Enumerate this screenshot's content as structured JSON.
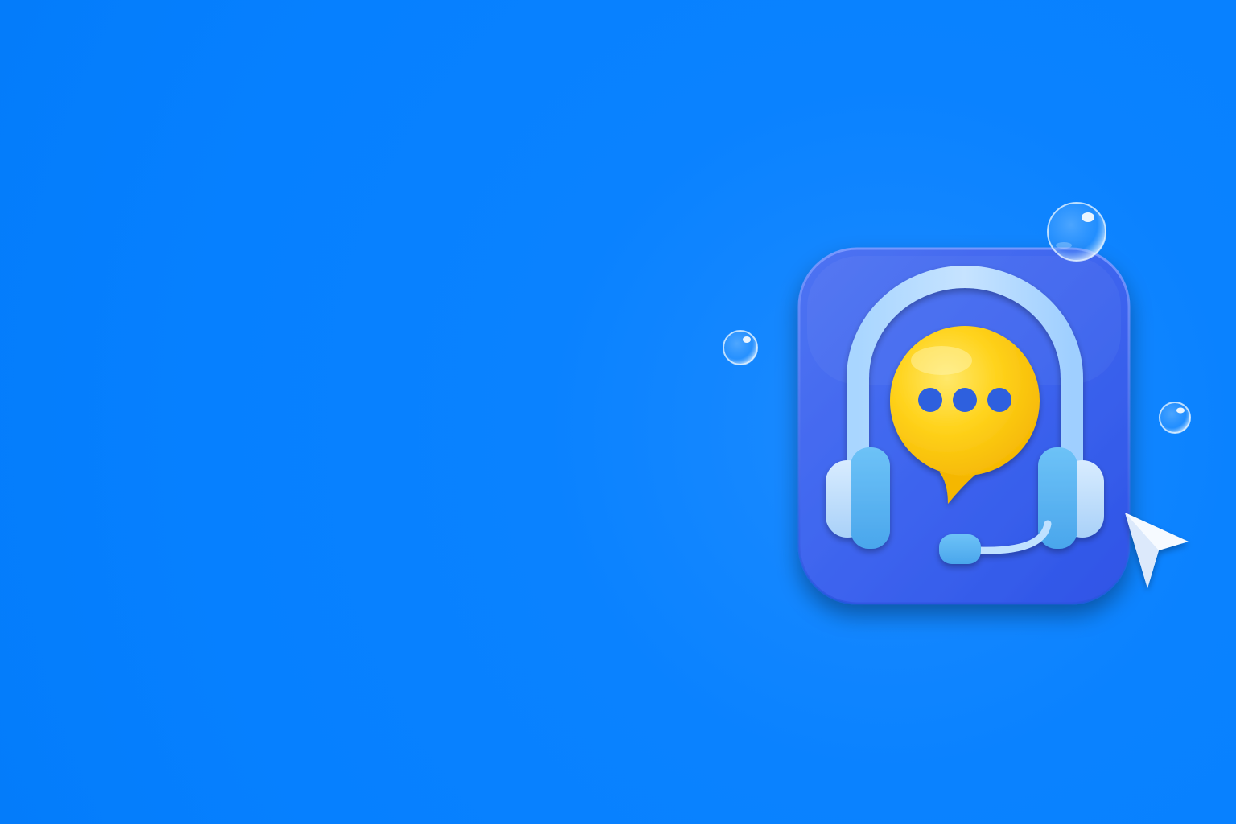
{
  "scene": {
    "background_color": "#0580FF",
    "app_icon": {
      "icon_name": "customer-support-headset-icon",
      "tile_color": "#3E67EE",
      "headset_color": "#9ED2FF",
      "ear_cup_color": "#5DB5F2",
      "speech_bubble_color": "#FFD21C",
      "typing_dot_count": 3,
      "typing_dot_color": "#2F61DE"
    },
    "cursor": {
      "icon_name": "pointer-arrow-icon",
      "color": "#FFFFFF"
    },
    "bubbles": {
      "icon_name": "water-droplet-icon",
      "count": 3
    }
  }
}
